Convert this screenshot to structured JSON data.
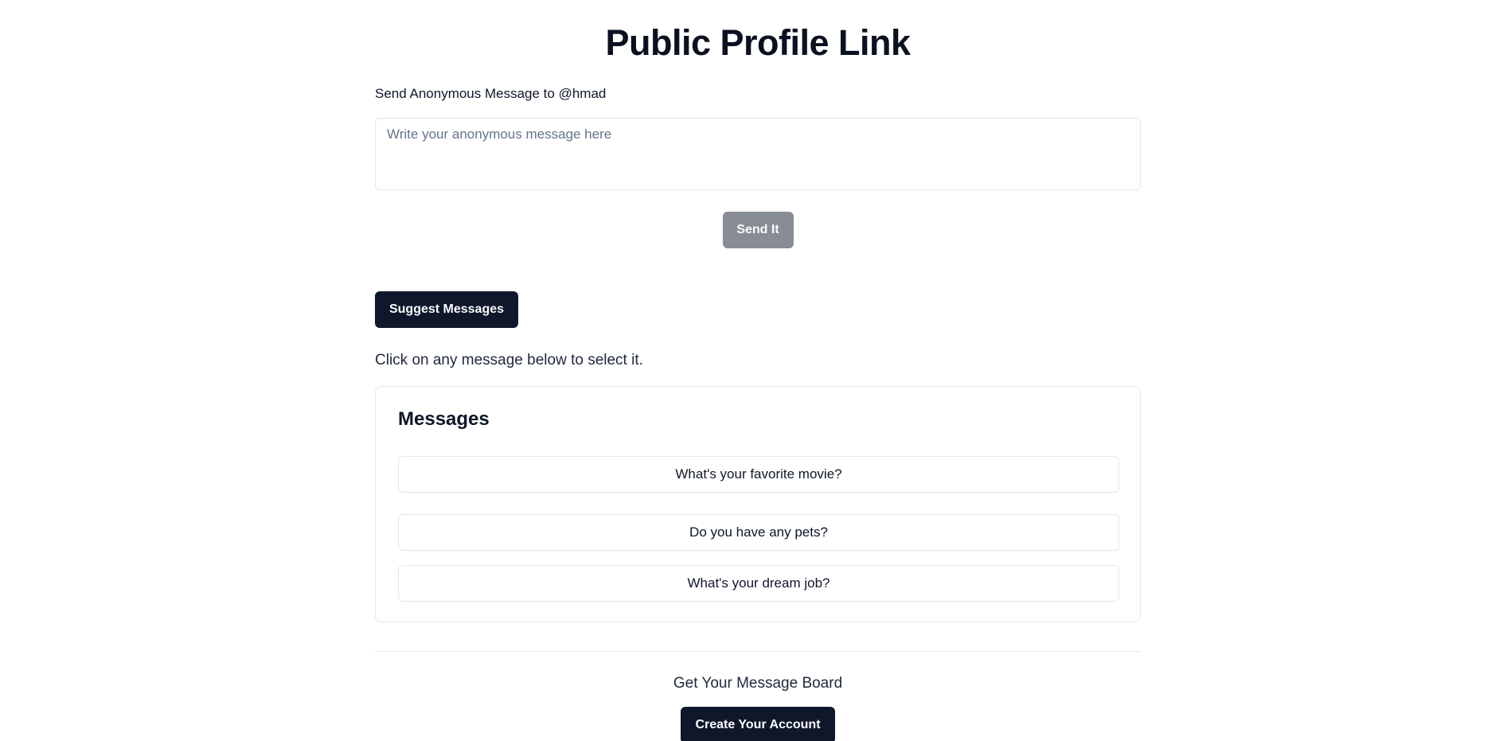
{
  "page": {
    "title": "Public Profile Link"
  },
  "form": {
    "label": "Send Anonymous Message to @hmad",
    "input_value": "",
    "input_placeholder": "Write your anonymous message here",
    "send_label": "Send It",
    "send_disabled": true
  },
  "suggest": {
    "button_label": "Suggest Messages",
    "hint": "Click on any message below to select it."
  },
  "messages": {
    "title": "Messages",
    "items": [
      "What's your favorite movie?",
      "Do you have any pets?",
      "What's your dream job?"
    ]
  },
  "footer": {
    "text": "Get Your Message Board",
    "button_label": "Create Your Account"
  },
  "colors": {
    "primary": "#0f172a",
    "disabled_button": "#888c94",
    "border": "#e2e8f0",
    "placeholder": "#64748b"
  }
}
